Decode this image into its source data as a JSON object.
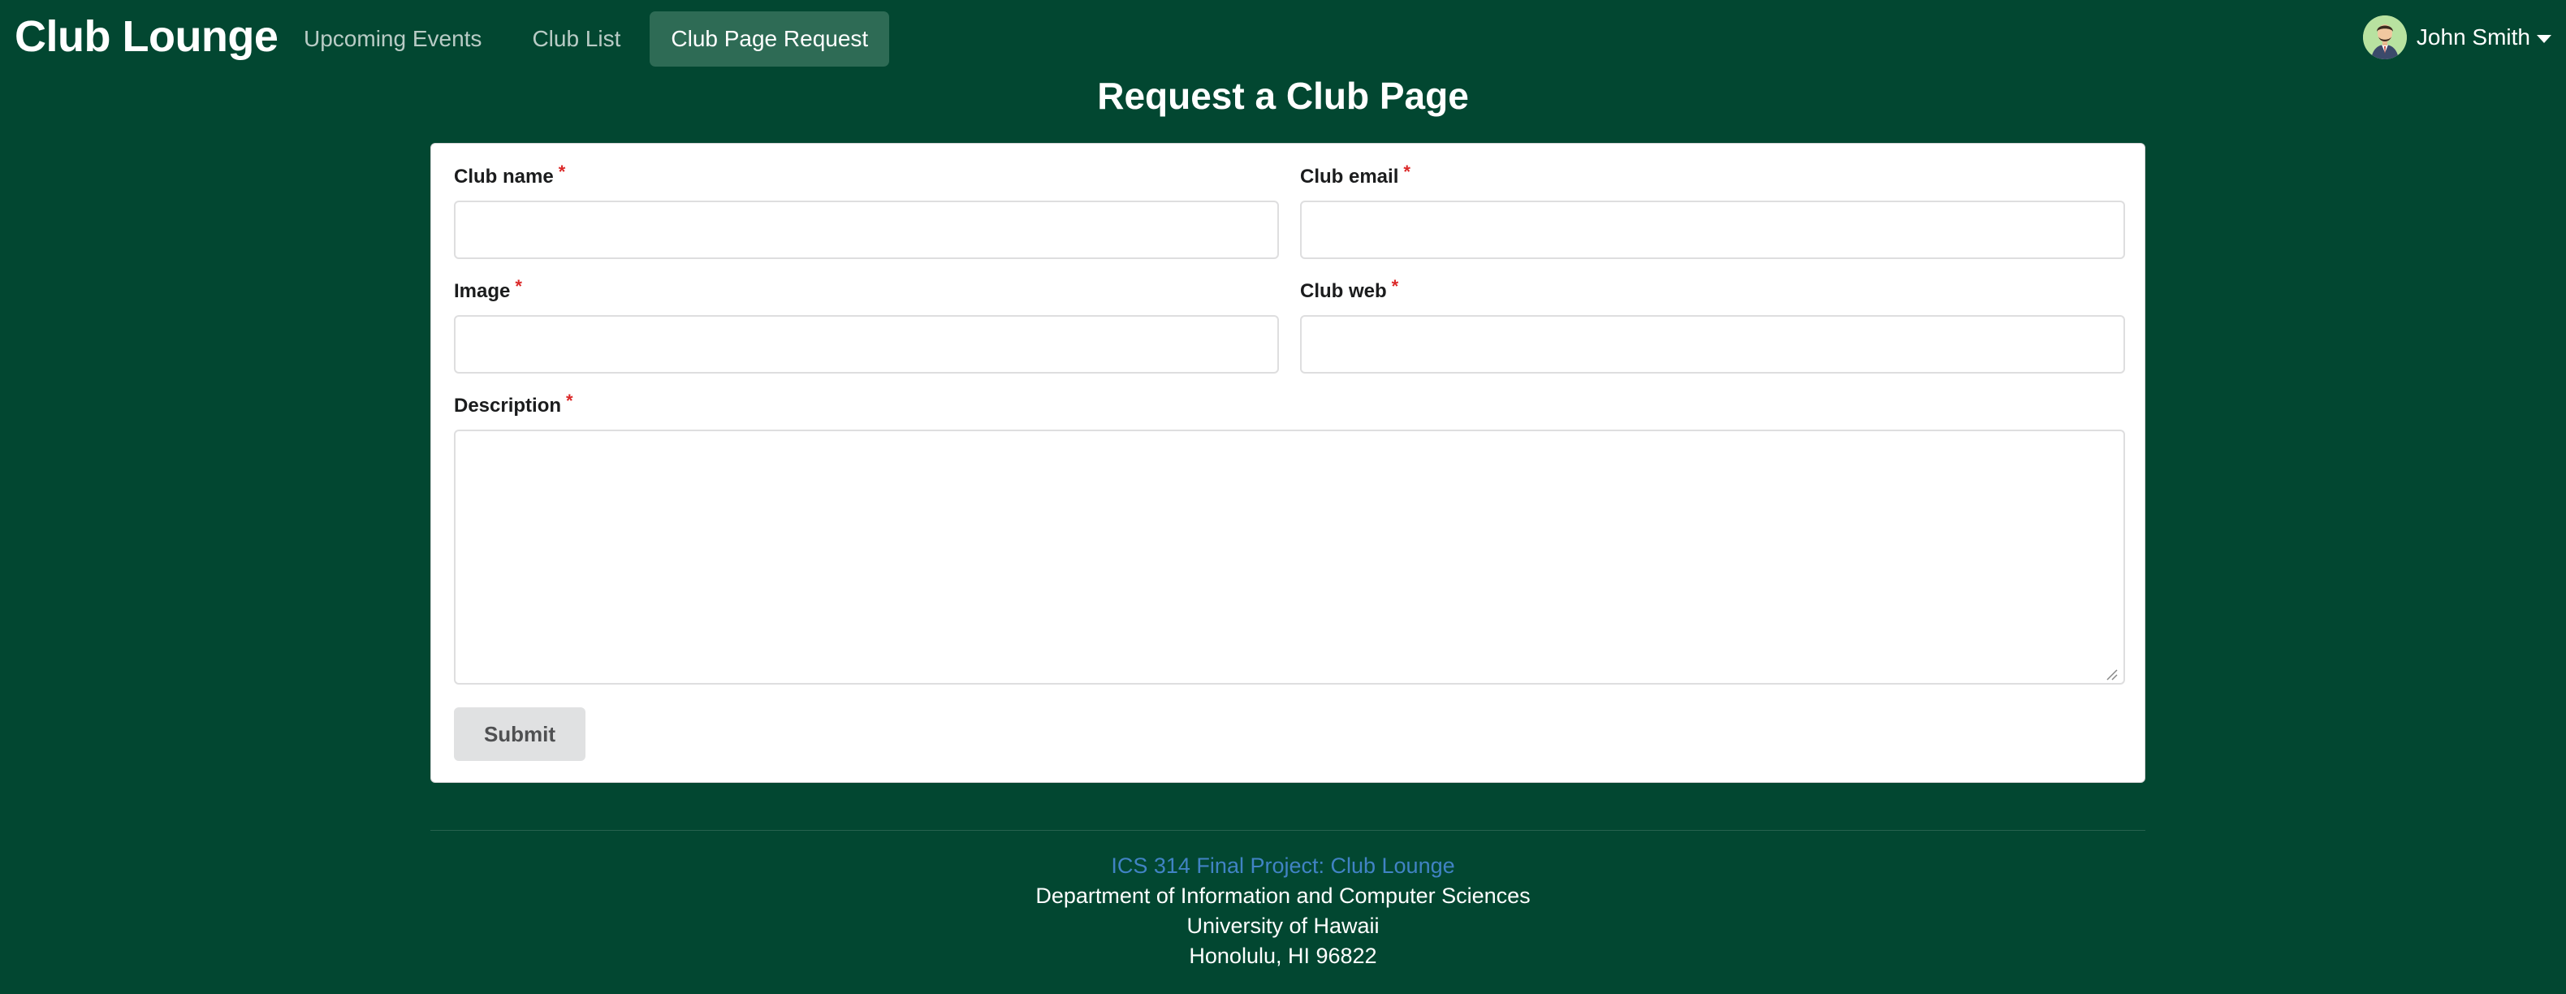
{
  "navbar": {
    "brand": "Club Lounge",
    "links": [
      {
        "label": "Upcoming Events",
        "active": false
      },
      {
        "label": "Club List",
        "active": false
      },
      {
        "label": "Club Page Request",
        "active": true
      }
    ],
    "user": {
      "name": "John Smith",
      "avatar_icon": "user-avatar-icon",
      "menu_icon": "caret-down-icon"
    }
  },
  "page": {
    "title": "Request a Club Page"
  },
  "form": {
    "required_marker": "*",
    "club_name": {
      "label": "Club name",
      "value": "",
      "placeholder": ""
    },
    "club_email": {
      "label": "Club email",
      "value": "",
      "placeholder": ""
    },
    "image": {
      "label": "Image",
      "value": "",
      "placeholder": ""
    },
    "club_web": {
      "label": "Club web",
      "value": "",
      "placeholder": ""
    },
    "description": {
      "label": "Description",
      "value": "",
      "placeholder": ""
    },
    "submit_label": "Submit"
  },
  "footer": {
    "link": "ICS 314 Final Project: Club Lounge",
    "department": "Department of Information and Computer Sciences",
    "university": "University of Hawaii",
    "address": "Honolulu, HI 96822"
  },
  "colors": {
    "background": "#024731",
    "active_tab": "#2e6b55",
    "required": "#db2828",
    "link": "#4183c4",
    "button": "#e0e1e2"
  }
}
